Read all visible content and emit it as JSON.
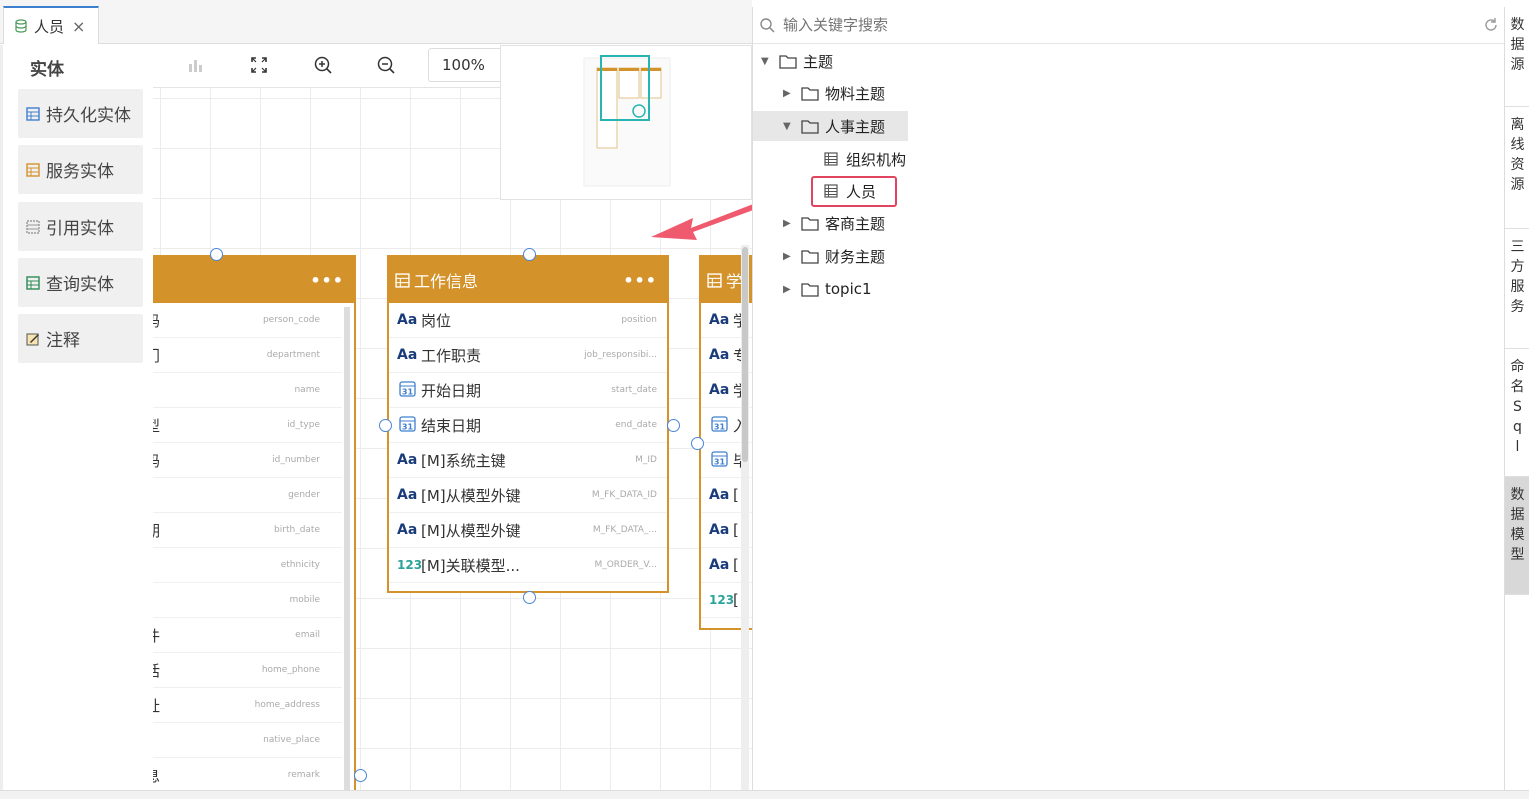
{
  "tab": {
    "label": "人员",
    "close": "×"
  },
  "palette": {
    "title": "实体",
    "items": [
      {
        "label": "持久化实体",
        "icon": "persistent-entity-icon",
        "color": "#3f7fd0"
      },
      {
        "label": "服务实体",
        "icon": "service-entity-icon",
        "color": "#d4922b"
      },
      {
        "label": "引用实体",
        "icon": "reference-entity-icon",
        "color": "#999999"
      },
      {
        "label": "查询实体",
        "icon": "query-entity-icon",
        "color": "#2e8b57"
      },
      {
        "label": "注释",
        "icon": "note-icon",
        "color": "#d4a12b"
      }
    ]
  },
  "toolbar": {
    "zoom": "100%"
  },
  "entities": {
    "left": {
      "rows": [
        {
          "cn": "码",
          "en": "person_code"
        },
        {
          "cn": "门",
          "en": "department"
        },
        {
          "cn": "",
          "en": "name"
        },
        {
          "cn": "型",
          "en": "id_type"
        },
        {
          "cn": "码",
          "en": "id_number"
        },
        {
          "cn": "",
          "en": "gender"
        },
        {
          "cn": "期",
          "en": "birth_date"
        },
        {
          "cn": "",
          "en": "ethnicity"
        },
        {
          "cn": "",
          "en": "mobile"
        },
        {
          "cn": "件",
          "en": "email"
        },
        {
          "cn": "话",
          "en": "home_phone"
        },
        {
          "cn": "址",
          "en": "home_address"
        },
        {
          "cn": "",
          "en": "native_place"
        },
        {
          "cn": "息",
          "en": "remark"
        }
      ]
    },
    "work": {
      "title": "工作信息",
      "more": "•••",
      "rows": [
        {
          "type": "Aa",
          "cn": "岗位",
          "en": "position"
        },
        {
          "type": "Aa",
          "cn": "工作职责",
          "en": "job_responsibi..."
        },
        {
          "type": "31",
          "cn": "开始日期",
          "en": "start_date"
        },
        {
          "type": "31",
          "cn": "结束日期",
          "en": "end_date"
        },
        {
          "type": "Aa",
          "cn": "[M]系统主键",
          "en": "M_ID"
        },
        {
          "type": "Aa",
          "cn": "[M]从模型外键",
          "en": "M_FK_DATA_ID"
        },
        {
          "type": "Aa",
          "cn": "[M]从模型外键",
          "en": "M_FK_DATA_..."
        },
        {
          "type": "123",
          "cn": "[M]关联模型...",
          "en": "M_ORDER_V..."
        }
      ]
    },
    "right": {
      "title": "学",
      "rows": [
        {
          "type": "Aa",
          "cn": "学"
        },
        {
          "type": "Aa",
          "cn": "专"
        },
        {
          "type": "Aa",
          "cn": "学"
        },
        {
          "type": "31",
          "cn": "入"
        },
        {
          "type": "31",
          "cn": "毕"
        },
        {
          "type": "Aa",
          "cn": "["
        },
        {
          "type": "Aa",
          "cn": "["
        },
        {
          "type": "Aa",
          "cn": "["
        },
        {
          "type": "123",
          "cn": "["
        }
      ]
    }
  },
  "tree": {
    "search_placeholder": "输入关键字搜索",
    "root": "主题",
    "nodes": [
      {
        "label": "物料主题"
      },
      {
        "label": "人事主题"
      },
      {
        "label": "组织机构"
      },
      {
        "label": "人员"
      },
      {
        "label": "客商主题"
      },
      {
        "label": "财务主题"
      },
      {
        "label": "topic1"
      }
    ]
  },
  "sidetabs": [
    {
      "chars": [
        "数",
        "据",
        "源"
      ]
    },
    {
      "chars": [
        "离",
        "线",
        "资",
        "源"
      ]
    },
    {
      "chars": [
        "三",
        "方",
        "服",
        "务"
      ]
    },
    {
      "chars": [
        "命",
        "名",
        "S",
        "q",
        "l"
      ]
    },
    {
      "chars": [
        "数",
        "据",
        "模",
        "型"
      ]
    }
  ],
  "colors": {
    "entity": "#d4922b",
    "accent": "#3f7fd0",
    "highlight": "#e0445e"
  }
}
